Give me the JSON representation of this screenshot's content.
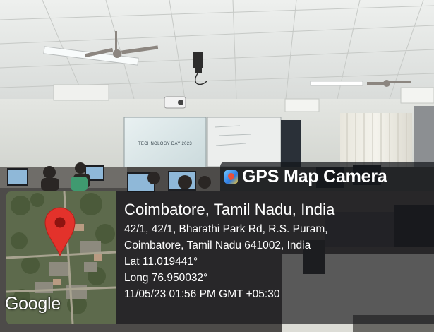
{
  "photo": {
    "scene": "computer lab",
    "projector_slide_text": "TECHNOLOGY DAY 2023"
  },
  "overlay": {
    "app_name": "GPS Map Camera",
    "app_icon": "gps-map-camera-icon",
    "map_provider": "Google",
    "map_pin_icon": "map-pin-icon",
    "city_line": "Coimbatore, Tamil Nadu, India",
    "address_line_1": "42/1, 42/1, Bharathi Park Rd, R.S. Puram,",
    "address_line_2": "Coimbatore, Tamil Nadu 641002, India",
    "latitude": "Lat 11.019441°",
    "longitude": "Long 76.950032°",
    "timestamp": "11/05/23 01:56 PM GMT +05:30",
    "pin_color": "#e3322b"
  }
}
